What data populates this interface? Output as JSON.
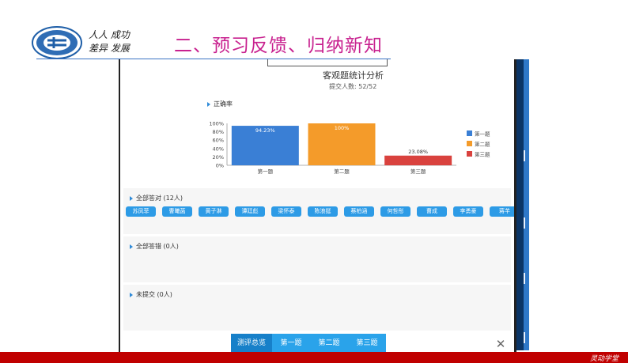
{
  "slide": {
    "motto_line1": "人人 成功",
    "motto_line2": "差异 发展",
    "title": "二、预习反馈、归纳新知",
    "footer_brand": "灵动学堂"
  },
  "panel": {
    "analysis_title": "客观题统计分析",
    "submit_count": "提交人数: 52/52",
    "accuracy_label": "正确率",
    "sections": {
      "all_correct": "全部答对  (12人)",
      "all_wrong": "全部答错  (0人)",
      "not_submitted": "未提交  (0人)"
    },
    "correct_names": [
      "苏凤菲",
      "曹曦菡",
      "黄子淋",
      "谭廷彪",
      "梁怀泰",
      "陈浪挺",
      "蔡柏涵",
      "何哲彤",
      "曹成",
      "李勇豪",
      "蒋芊"
    ],
    "tabs": [
      "测评总览",
      "第一题",
      "第二题",
      "第三题"
    ],
    "active_tab": "测评总览",
    "close_glyph": "✕"
  },
  "chart_data": {
    "type": "bar",
    "categories": [
      "第一题",
      "第二题",
      "第三题"
    ],
    "values": [
      94.23,
      100,
      23.08
    ],
    "data_labels": [
      "94.23%",
      "100%",
      "23.08%"
    ],
    "colors": [
      "#3a7fd5",
      "#f49b2a",
      "#d9423e"
    ],
    "yticks": [
      "100%",
      "80%",
      "60%",
      "40%",
      "20%",
      "0%"
    ],
    "ylim": [
      0,
      100
    ],
    "legend": [
      "第一题",
      "第二题",
      "第三题"
    ],
    "legend_position": "right",
    "grid": false
  }
}
